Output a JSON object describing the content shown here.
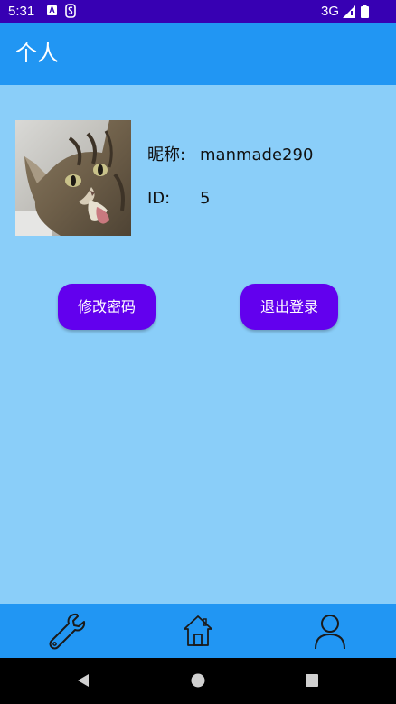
{
  "status_bar": {
    "time": "5:31",
    "notification_icon_a": "A",
    "network": "3G"
  },
  "app_bar": {
    "title": "个人"
  },
  "profile": {
    "nickname_label": "昵称:",
    "nickname_value": "manmade290",
    "id_label": "ID:",
    "id_value": "5"
  },
  "actions": {
    "change_password_label": "修改密码",
    "logout_label": "退出登录"
  },
  "bottom_nav": {
    "items": [
      {
        "icon": "wrench-icon"
      },
      {
        "icon": "home-icon"
      },
      {
        "icon": "person-icon"
      }
    ]
  },
  "colors": {
    "status_bar": "#3700B3",
    "app_bar": "#2196F3",
    "background": "#8ACEF9",
    "button": "#6200EE"
  }
}
